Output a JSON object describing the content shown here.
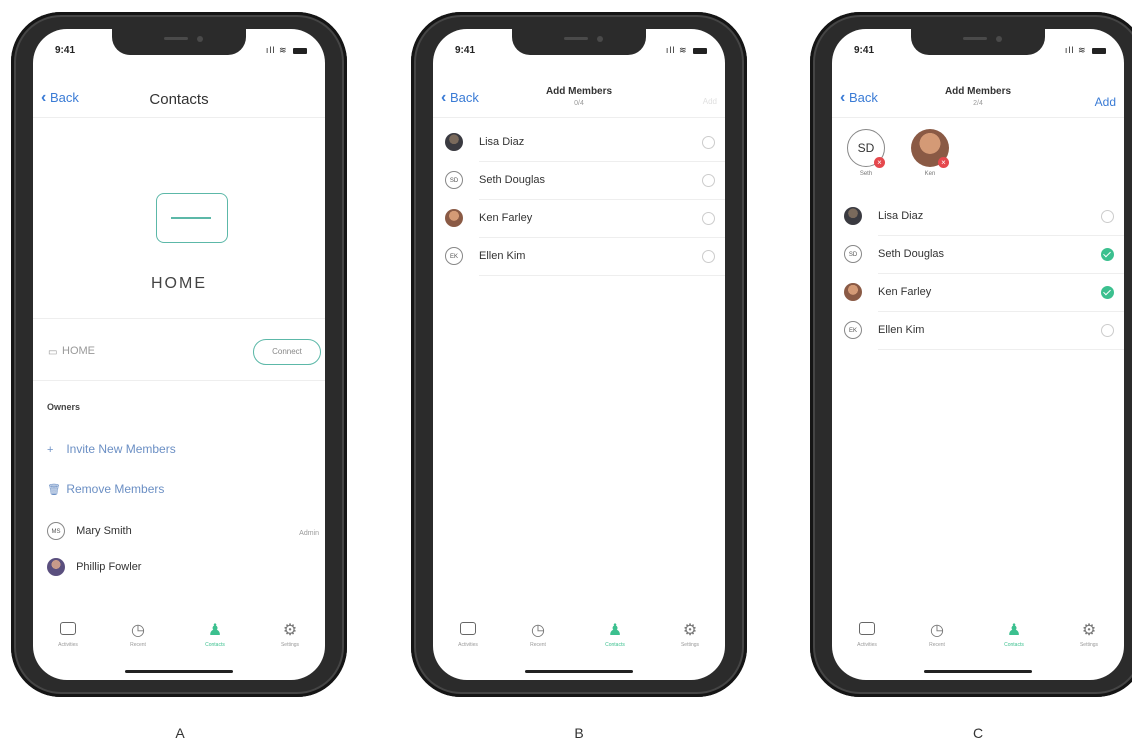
{
  "status": {
    "time": "9:41"
  },
  "tabs": [
    {
      "icon": "tv-icon",
      "label": "Activities"
    },
    {
      "icon": "clock-icon",
      "label": "Recent"
    },
    {
      "icon": "person-icon",
      "label": "Contacts",
      "active": true
    },
    {
      "icon": "gear-icon",
      "label": "Settings"
    }
  ],
  "accent_color": "#3cc08f",
  "link_color": "#3a7bd5",
  "screen_a": {
    "caption": "A",
    "back": "Back",
    "title": "Contacts",
    "device_name": "HOME",
    "device_row_label": "HOME",
    "connect": "Connect",
    "owners_label": "Owners",
    "invite": "Invite New Members",
    "remove": "Remove Members",
    "members": [
      {
        "initials": "MS",
        "name": "Mary Smith",
        "badge": "Admin"
      },
      {
        "name": "Phillip Fowler"
      }
    ]
  },
  "screen_b": {
    "caption": "B",
    "back": "Back",
    "title": "Add Members",
    "subtitle": "0/4",
    "action": "Add",
    "contacts": [
      {
        "name": "Lisa Diaz"
      },
      {
        "initials": "SD",
        "name": "Seth Douglas"
      },
      {
        "name": "Ken Farley"
      },
      {
        "initials": "EK",
        "name": "Ellen Kim"
      }
    ]
  },
  "screen_c": {
    "caption": "C",
    "back": "Back",
    "title": "Add Members",
    "subtitle": "2/4",
    "action": "Add",
    "selected": [
      {
        "initials": "SD",
        "label": "Seth"
      },
      {
        "label": "Ken"
      }
    ],
    "contacts": [
      {
        "name": "Lisa Diaz",
        "checked": false
      },
      {
        "initials": "SD",
        "name": "Seth Douglas",
        "checked": true
      },
      {
        "name": "Ken Farley",
        "checked": true
      },
      {
        "initials": "EK",
        "name": "Ellen Kim",
        "checked": false
      }
    ]
  }
}
